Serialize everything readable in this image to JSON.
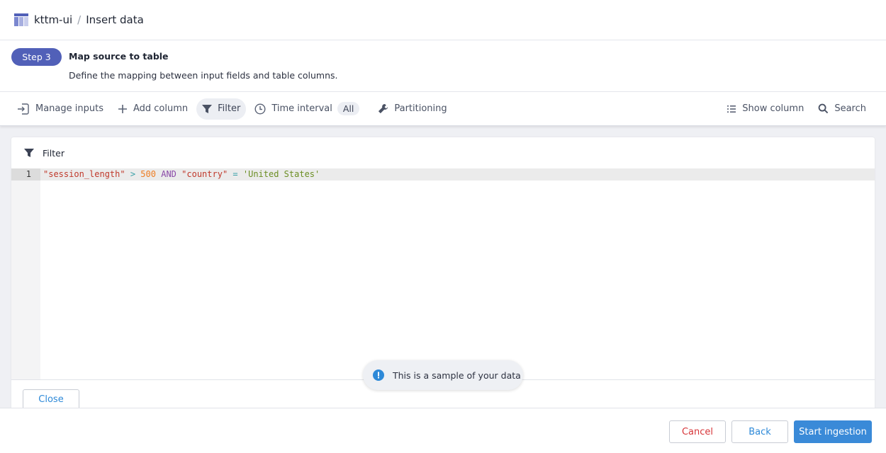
{
  "header": {
    "app_name": "kttm-ui",
    "separator": "/",
    "page_title": "Insert data",
    "logo_icon": "table-icon"
  },
  "step": {
    "badge": "Step 3",
    "title": "Map source to table",
    "description": "Define the mapping between input fields and table columns."
  },
  "toolbar": {
    "manage_inputs": "Manage inputs",
    "add_column": "Add column",
    "filter": "Filter",
    "time_interval": "Time interval",
    "time_interval_value": "All",
    "partitioning": "Partitioning",
    "show_column": "Show column",
    "search": "Search"
  },
  "filter_panel": {
    "title": "Filter",
    "line_number": "1",
    "tokens": [
      {
        "type": "str",
        "text": "\"session_length\""
      },
      {
        "type": "pl",
        "text": " "
      },
      {
        "type": "op",
        "text": ">"
      },
      {
        "type": "pl",
        "text": " "
      },
      {
        "type": "num",
        "text": "500"
      },
      {
        "type": "pl",
        "text": " "
      },
      {
        "type": "kw",
        "text": "AND"
      },
      {
        "type": "pl",
        "text": " "
      },
      {
        "type": "str",
        "text": "\"country\""
      },
      {
        "type": "pl",
        "text": " "
      },
      {
        "type": "op",
        "text": "="
      },
      {
        "type": "pl",
        "text": " "
      },
      {
        "type": "lit",
        "text": "'United States'"
      }
    ],
    "close_label": "Close"
  },
  "toast": {
    "message": "This is a sample of your data",
    "icon": "info-icon"
  },
  "footer": {
    "cancel": "Cancel",
    "back": "Back",
    "start": "Start ingestion"
  },
  "colors": {
    "badge": "#5160b8",
    "primary": "#3a8ad8",
    "danger": "#d7363a"
  }
}
